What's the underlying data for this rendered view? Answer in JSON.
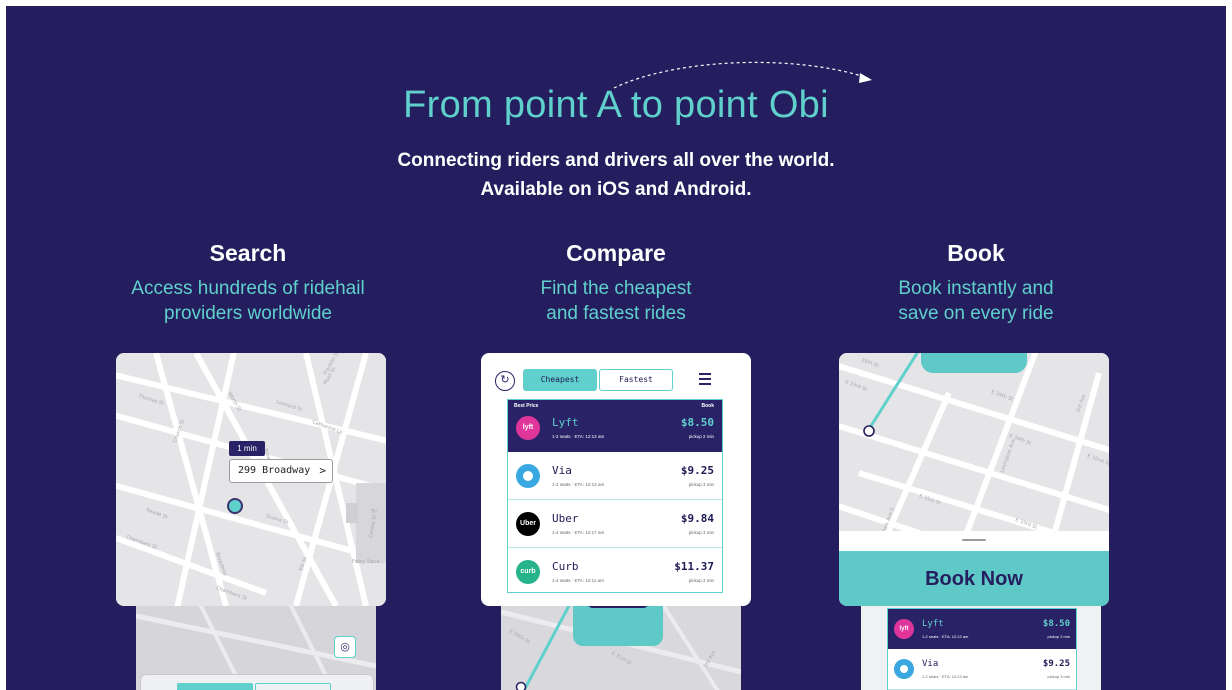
{
  "hero": {
    "title": "From point A to point Obi",
    "subtitle_line1": "Connecting riders and drivers all over the world.",
    "subtitle_line2": "Available on iOS and Android."
  },
  "features": [
    {
      "heading": "Search",
      "description": "Access hundreds of ridehail\nproviders worldwide"
    },
    {
      "heading": "Compare",
      "description": "Find the cheapest\nand fastest rides"
    },
    {
      "heading": "Book",
      "description": "Book instantly and\nsave on every ride"
    }
  ],
  "search_card": {
    "eta": "1 min",
    "address": "299 Broadway",
    "chevron": ">",
    "streets": [
      "Thomas St",
      "Worth St",
      "Leonard St",
      "Franklin St",
      "Church St",
      "Catherine Ln",
      "Broadway",
      "Duane St",
      "Reade St",
      "Chambers St",
      "Chambers St",
      "Foley Squa",
      "Elk St",
      "Broadway",
      "Pearl St",
      "Centre St",
      "Tri"
    ]
  },
  "compare_card": {
    "tab_cheapest": "Cheapest",
    "tab_fastest": "Fastest",
    "best_price_label": "Best Price",
    "book_label": "Book",
    "refresh_icon": "refresh-icon",
    "rides": [
      {
        "name": "Lyft",
        "logo": "lyft",
        "details": "1-2 seats · ETA: 12:13 am",
        "price": "$8.50",
        "pickup": "pickup 2 min"
      },
      {
        "name": "Via",
        "logo": "",
        "details": "1-2 seats · ETA: 12:13 am",
        "price": "$9.25",
        "pickup": "pickup 3 min"
      },
      {
        "name": "Uber",
        "logo": "Uber",
        "details": "1-4 seats · ETA: 12:17 am",
        "price": "$9.84",
        "pickup": "pickup 3 min"
      },
      {
        "name": "Curb",
        "logo": "curb",
        "details": "1-4 seats · ETA: 12:11 am",
        "price": "$11.37",
        "pickup": "pickup 2 min"
      }
    ]
  },
  "book_card": {
    "button": "Book Now",
    "streets": [
      "E 34th St",
      "E 33rd St",
      "E 34th St",
      "Lexington Ave",
      "3rd Ave",
      "E 31st St",
      "Park Ave S",
      "E 33rd St",
      "E 32nd St",
      "36th St"
    ]
  },
  "phones": {
    "compare_streets": [
      "E 30th St",
      "E 31st St",
      "3rd Ave"
    ],
    "book_rides": [
      {
        "name": "Lyft",
        "logo": "lyft",
        "details": "1-2 seats · ETA: 12:13 am",
        "price": "$8.50",
        "pickup": "pickup 2 min"
      },
      {
        "name": "Via",
        "logo": "",
        "details": "1-2 seats · ETA: 12:13 am",
        "price": "$9.25",
        "pickup": "pickup 3 min"
      }
    ]
  },
  "colors": {
    "background": "#241e5e",
    "accent": "#5fd0cc",
    "dark": "#2a2266"
  }
}
